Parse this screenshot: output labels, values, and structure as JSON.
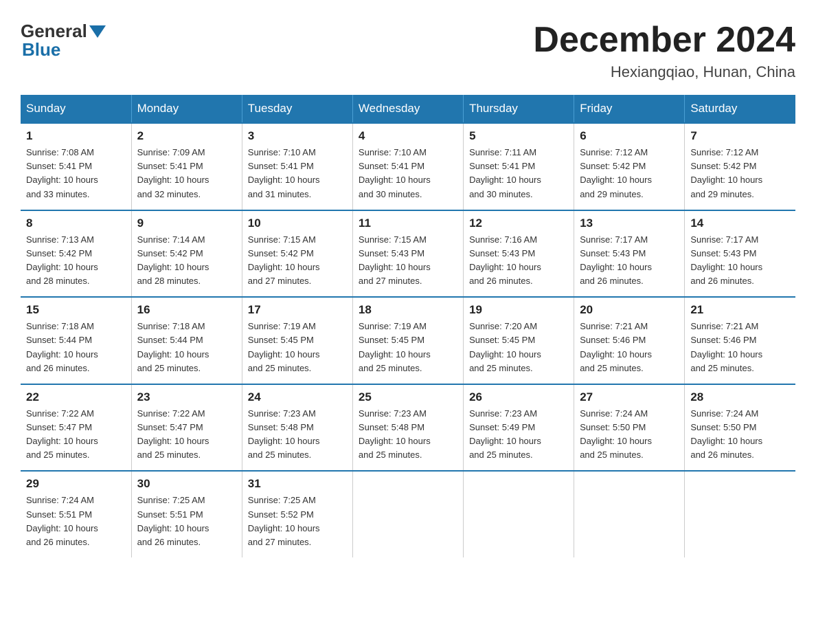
{
  "logo": {
    "general": "General",
    "blue": "Blue"
  },
  "header": {
    "month": "December 2024",
    "location": "Hexiangqiao, Hunan, China"
  },
  "weekdays": [
    "Sunday",
    "Monday",
    "Tuesday",
    "Wednesday",
    "Thursday",
    "Friday",
    "Saturday"
  ],
  "weeks": [
    [
      {
        "day": "1",
        "sunrise": "7:08 AM",
        "sunset": "5:41 PM",
        "daylight": "10 hours and 33 minutes."
      },
      {
        "day": "2",
        "sunrise": "7:09 AM",
        "sunset": "5:41 PM",
        "daylight": "10 hours and 32 minutes."
      },
      {
        "day": "3",
        "sunrise": "7:10 AM",
        "sunset": "5:41 PM",
        "daylight": "10 hours and 31 minutes."
      },
      {
        "day": "4",
        "sunrise": "7:10 AM",
        "sunset": "5:41 PM",
        "daylight": "10 hours and 30 minutes."
      },
      {
        "day": "5",
        "sunrise": "7:11 AM",
        "sunset": "5:41 PM",
        "daylight": "10 hours and 30 minutes."
      },
      {
        "day": "6",
        "sunrise": "7:12 AM",
        "sunset": "5:42 PM",
        "daylight": "10 hours and 29 minutes."
      },
      {
        "day": "7",
        "sunrise": "7:12 AM",
        "sunset": "5:42 PM",
        "daylight": "10 hours and 29 minutes."
      }
    ],
    [
      {
        "day": "8",
        "sunrise": "7:13 AM",
        "sunset": "5:42 PM",
        "daylight": "10 hours and 28 minutes."
      },
      {
        "day": "9",
        "sunrise": "7:14 AM",
        "sunset": "5:42 PM",
        "daylight": "10 hours and 28 minutes."
      },
      {
        "day": "10",
        "sunrise": "7:15 AM",
        "sunset": "5:42 PM",
        "daylight": "10 hours and 27 minutes."
      },
      {
        "day": "11",
        "sunrise": "7:15 AM",
        "sunset": "5:43 PM",
        "daylight": "10 hours and 27 minutes."
      },
      {
        "day": "12",
        "sunrise": "7:16 AM",
        "sunset": "5:43 PM",
        "daylight": "10 hours and 26 minutes."
      },
      {
        "day": "13",
        "sunrise": "7:17 AM",
        "sunset": "5:43 PM",
        "daylight": "10 hours and 26 minutes."
      },
      {
        "day": "14",
        "sunrise": "7:17 AM",
        "sunset": "5:43 PM",
        "daylight": "10 hours and 26 minutes."
      }
    ],
    [
      {
        "day": "15",
        "sunrise": "7:18 AM",
        "sunset": "5:44 PM",
        "daylight": "10 hours and 26 minutes."
      },
      {
        "day": "16",
        "sunrise": "7:18 AM",
        "sunset": "5:44 PM",
        "daylight": "10 hours and 25 minutes."
      },
      {
        "day": "17",
        "sunrise": "7:19 AM",
        "sunset": "5:45 PM",
        "daylight": "10 hours and 25 minutes."
      },
      {
        "day": "18",
        "sunrise": "7:19 AM",
        "sunset": "5:45 PM",
        "daylight": "10 hours and 25 minutes."
      },
      {
        "day": "19",
        "sunrise": "7:20 AM",
        "sunset": "5:45 PM",
        "daylight": "10 hours and 25 minutes."
      },
      {
        "day": "20",
        "sunrise": "7:21 AM",
        "sunset": "5:46 PM",
        "daylight": "10 hours and 25 minutes."
      },
      {
        "day": "21",
        "sunrise": "7:21 AM",
        "sunset": "5:46 PM",
        "daylight": "10 hours and 25 minutes."
      }
    ],
    [
      {
        "day": "22",
        "sunrise": "7:22 AM",
        "sunset": "5:47 PM",
        "daylight": "10 hours and 25 minutes."
      },
      {
        "day": "23",
        "sunrise": "7:22 AM",
        "sunset": "5:47 PM",
        "daylight": "10 hours and 25 minutes."
      },
      {
        "day": "24",
        "sunrise": "7:23 AM",
        "sunset": "5:48 PM",
        "daylight": "10 hours and 25 minutes."
      },
      {
        "day": "25",
        "sunrise": "7:23 AM",
        "sunset": "5:48 PM",
        "daylight": "10 hours and 25 minutes."
      },
      {
        "day": "26",
        "sunrise": "7:23 AM",
        "sunset": "5:49 PM",
        "daylight": "10 hours and 25 minutes."
      },
      {
        "day": "27",
        "sunrise": "7:24 AM",
        "sunset": "5:50 PM",
        "daylight": "10 hours and 25 minutes."
      },
      {
        "day": "28",
        "sunrise": "7:24 AM",
        "sunset": "5:50 PM",
        "daylight": "10 hours and 26 minutes."
      }
    ],
    [
      {
        "day": "29",
        "sunrise": "7:24 AM",
        "sunset": "5:51 PM",
        "daylight": "10 hours and 26 minutes."
      },
      {
        "day": "30",
        "sunrise": "7:25 AM",
        "sunset": "5:51 PM",
        "daylight": "10 hours and 26 minutes."
      },
      {
        "day": "31",
        "sunrise": "7:25 AM",
        "sunset": "5:52 PM",
        "daylight": "10 hours and 27 minutes."
      },
      null,
      null,
      null,
      null
    ]
  ],
  "labels": {
    "sunrise": "Sunrise:",
    "sunset": "Sunset:",
    "daylight": "Daylight:"
  }
}
